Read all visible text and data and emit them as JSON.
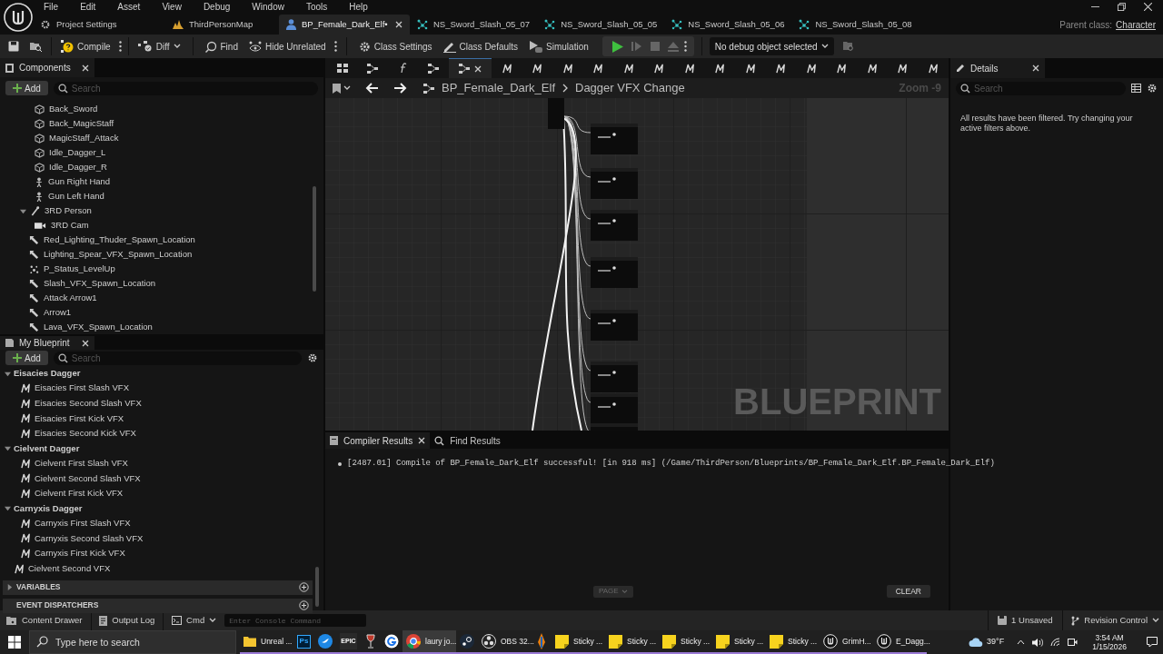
{
  "menu": [
    "File",
    "Edit",
    "Asset",
    "View",
    "Debug",
    "Window",
    "Tools",
    "Help"
  ],
  "tabs": [
    {
      "label": "Project Settings",
      "kind": "settings",
      "selected": false
    },
    {
      "label": "ThirdPersonMap",
      "kind": "map",
      "selected": false
    },
    {
      "label": "BP_Female_Dark_Elf•",
      "kind": "blueprint",
      "selected": true
    },
    {
      "label": "NS_Sword_Slash_05_07",
      "kind": "niagara",
      "selected": false
    },
    {
      "label": "NS_Sword_Slash_05_05",
      "kind": "niagara",
      "selected": false
    },
    {
      "label": "NS_Sword_Slash_05_06",
      "kind": "niagara",
      "selected": false
    },
    {
      "label": "NS_Sword_Slash_05_08",
      "kind": "niagara",
      "selected": false
    }
  ],
  "parent_class": {
    "label": "Parent class:",
    "value": "Character"
  },
  "toolbar": {
    "compile": "Compile",
    "diff": "Diff",
    "find": "Find",
    "hide_unrelated": "Hide Unrelated",
    "class_settings": "Class Settings",
    "class_defaults": "Class Defaults",
    "simulation": "Simulation",
    "debug_object": "No debug object selected"
  },
  "components": {
    "title": "Components",
    "add": "Add",
    "search_placeholder": "Search",
    "nested_items": [
      {
        "label": "Back_Sword",
        "kind": "mesh"
      },
      {
        "label": "Back_MagicStaff",
        "kind": "mesh"
      },
      {
        "label": "MagicStaff_Attack",
        "kind": "mesh"
      },
      {
        "label": "Idle_Dagger_L",
        "kind": "mesh"
      },
      {
        "label": "Idle_Dagger_R",
        "kind": "mesh"
      },
      {
        "label": "Gun Right Hand",
        "kind": "skeletal"
      },
      {
        "label": "Gun Left Hand",
        "kind": "skeletal"
      }
    ],
    "items": [
      {
        "label": "3RD Person",
        "kind": "spring_arm",
        "expanded": true,
        "children": [
          {
            "label": "3RD Cam",
            "kind": "camera"
          }
        ]
      },
      {
        "label": "Red_Lighting_Thuder_Spawn_Location",
        "kind": "arrow"
      },
      {
        "label": "Lighting_Spear_VFX_Spawn_Location",
        "kind": "arrow"
      },
      {
        "label": "P_Status_LevelUp",
        "kind": "particle"
      },
      {
        "label": "Slash_VFX_Spawn_Location",
        "kind": "arrow"
      },
      {
        "label": "Attack Arrow1",
        "kind": "arrow"
      },
      {
        "label": "Arrow1",
        "kind": "arrow"
      },
      {
        "label": "Lava_VFX_Spawn_Location",
        "kind": "arrow"
      }
    ]
  },
  "my_blueprint": {
    "title": "My Blueprint",
    "add": "Add",
    "search_placeholder": "Search",
    "categories": [
      {
        "label": "Eisacies Dagger",
        "expanded": true,
        "children": [
          {
            "label": "Eisacies First Slash VFX"
          },
          {
            "label": "Eisacies Second Slash VFX"
          },
          {
            "label": "Eisacies First Kick VFX"
          },
          {
            "label": "Eisacies Second Kick VFX"
          }
        ]
      },
      {
        "label": "Cielvent Dagger",
        "expanded": true,
        "children": [
          {
            "label": "Cielvent First Slash VFX"
          },
          {
            "label": "Cielvent Second Slash VFX"
          },
          {
            "label": "Cielvent First  Kick VFX"
          }
        ]
      },
      {
        "label": "Carnyxis Dagger",
        "expanded": true,
        "children": [
          {
            "label": "Carnyxis First Slash VFX"
          },
          {
            "label": "Carnyxis Second Slash VFX"
          },
          {
            "label": "Carnyxis First Kick VFX"
          }
        ]
      }
    ],
    "loose_items": [
      {
        "label": "Cielvent Second VFX"
      }
    ],
    "sections": [
      {
        "label": "VARIABLES",
        "kind": "collapsible"
      },
      {
        "label": "EVENT DISPATCHERS",
        "kind": "plain"
      }
    ]
  },
  "graph": {
    "tabs": [
      {
        "kind": "viewport",
        "selected": false
      },
      {
        "kind": "construction",
        "selected": false
      },
      {
        "kind": "function",
        "selected": false
      },
      {
        "kind": "graph",
        "selected": false
      },
      {
        "kind": "graph",
        "selected": true
      },
      {
        "kind": "macro",
        "selected": false
      },
      {
        "kind": "macro",
        "selected": false
      },
      {
        "kind": "macro",
        "selected": false
      },
      {
        "kind": "macro",
        "selected": false
      },
      {
        "kind": "macro",
        "selected": false
      },
      {
        "kind": "macro",
        "selected": false
      },
      {
        "kind": "macro",
        "selected": false
      },
      {
        "kind": "macro",
        "selected": false
      },
      {
        "kind": "macro",
        "selected": false
      },
      {
        "kind": "macro",
        "selected": false
      },
      {
        "kind": "macro",
        "selected": false
      },
      {
        "kind": "macro",
        "selected": false
      },
      {
        "kind": "macro",
        "selected": false
      },
      {
        "kind": "macro",
        "selected": false
      },
      {
        "kind": "macro",
        "selected": false
      }
    ],
    "breadcrumb": [
      "BP_Female_Dark_Elf",
      "Dagger VFX Change"
    ],
    "zoom": "Zoom -9",
    "watermark": "BLUEPRINT"
  },
  "details": {
    "title": "Details",
    "search_placeholder": "Search",
    "message": "All results have been filtered. Try changing your active filters above."
  },
  "results": {
    "tabs": [
      {
        "label": "Compiler Results",
        "selected": true
      },
      {
        "label": "Find Results",
        "selected": false
      }
    ],
    "messages": [
      "[2487.01] Compile of BP_Female_Dark_Elf successful! [in 918 ms] (/Game/ThirdPerson/Blueprints/BP_Female_Dark_Elf.BP_Female_Dark_Elf)"
    ],
    "page": "PAGE",
    "clear": "CLEAR"
  },
  "status_bar": {
    "content_drawer": "Content Drawer",
    "output_log": "Output Log",
    "cmd": "Cmd",
    "console_placeholder": "Enter Console Command",
    "unsaved": "1 Unsaved",
    "revision_control": "Revision Control"
  },
  "taskbar": {
    "search_placeholder": "Type here to search",
    "apps": [
      {
        "kind": "folder",
        "label": "Unreal ...",
        "selected": false
      },
      {
        "kind": "ps",
        "icon_text": "Ps",
        "selected": false
      },
      {
        "kind": "bluebird",
        "selected": false
      },
      {
        "kind": "epic",
        "icon_text": "EPIC",
        "selected": false
      },
      {
        "kind": "wine",
        "selected": false
      },
      {
        "kind": "gicon",
        "selected": false
      },
      {
        "kind": "chrome",
        "label": "laury jo...",
        "selected": true
      },
      {
        "kind": "steam",
        "selected": false
      },
      {
        "kind": "obs",
        "label": "OBS 32...",
        "selected": false
      },
      {
        "kind": "blender",
        "selected": false
      },
      {
        "kind": "sticky",
        "label": "Sticky ...",
        "selected": false
      },
      {
        "kind": "sticky",
        "label": "Sticky ...",
        "selected": false
      },
      {
        "kind": "sticky",
        "label": "Sticky ...",
        "selected": false
      },
      {
        "kind": "sticky",
        "label": "Sticky ...",
        "selected": false
      },
      {
        "kind": "sticky",
        "label": "Sticky ...",
        "selected": false
      },
      {
        "kind": "unreal",
        "label": "GrimH...",
        "selected": false
      },
      {
        "kind": "unreal",
        "label": "E_Dagg...",
        "selected": false
      }
    ],
    "weather": "39°F",
    "time": "3:54 AM",
    "date": "1/15/2026"
  }
}
